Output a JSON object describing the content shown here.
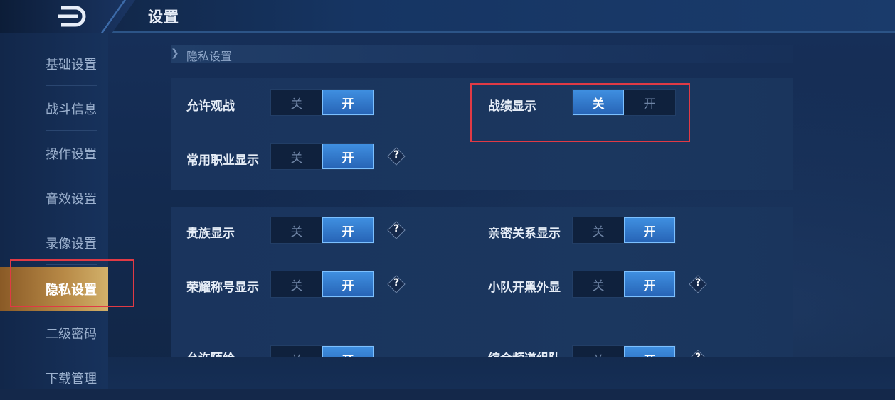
{
  "header": {
    "title": "设置"
  },
  "sidebar": {
    "items": [
      {
        "label": "基础设置"
      },
      {
        "label": "战斗信息"
      },
      {
        "label": "操作设置"
      },
      {
        "label": "音效设置"
      },
      {
        "label": "录像设置"
      },
      {
        "label": "隐私设置"
      },
      {
        "label": "二级密码"
      },
      {
        "label": "下载管理"
      }
    ],
    "active": "隐私设置"
  },
  "section": {
    "title": "隐私设置"
  },
  "toggle_labels": {
    "off": "关",
    "on": "开"
  },
  "settings": {
    "allow_spectate": {
      "label": "允许观战",
      "value": "开"
    },
    "record_display": {
      "label": "战绩显示",
      "value": "关"
    },
    "common_role_display": {
      "label": "常用职业显示",
      "value": "开"
    },
    "noble_display": {
      "label": "贵族显示",
      "value": "开"
    },
    "intimacy_display": {
      "label": "亲密关系显示",
      "value": "开"
    },
    "honor_title_display": {
      "label": "荣耀称号显示",
      "value": "开"
    },
    "team_display": {
      "label": "小队开黑外显",
      "value": "开"
    },
    "partial_row_1": {
      "label": "允许陌给",
      "value": "开"
    },
    "partial_row_2": {
      "label": "综合频道组队",
      "value": "开"
    }
  },
  "help_icon": "?",
  "colors": {
    "accent": "#3f8fe0",
    "highlight": "#e03a45",
    "active_tab": "#b88a47"
  }
}
